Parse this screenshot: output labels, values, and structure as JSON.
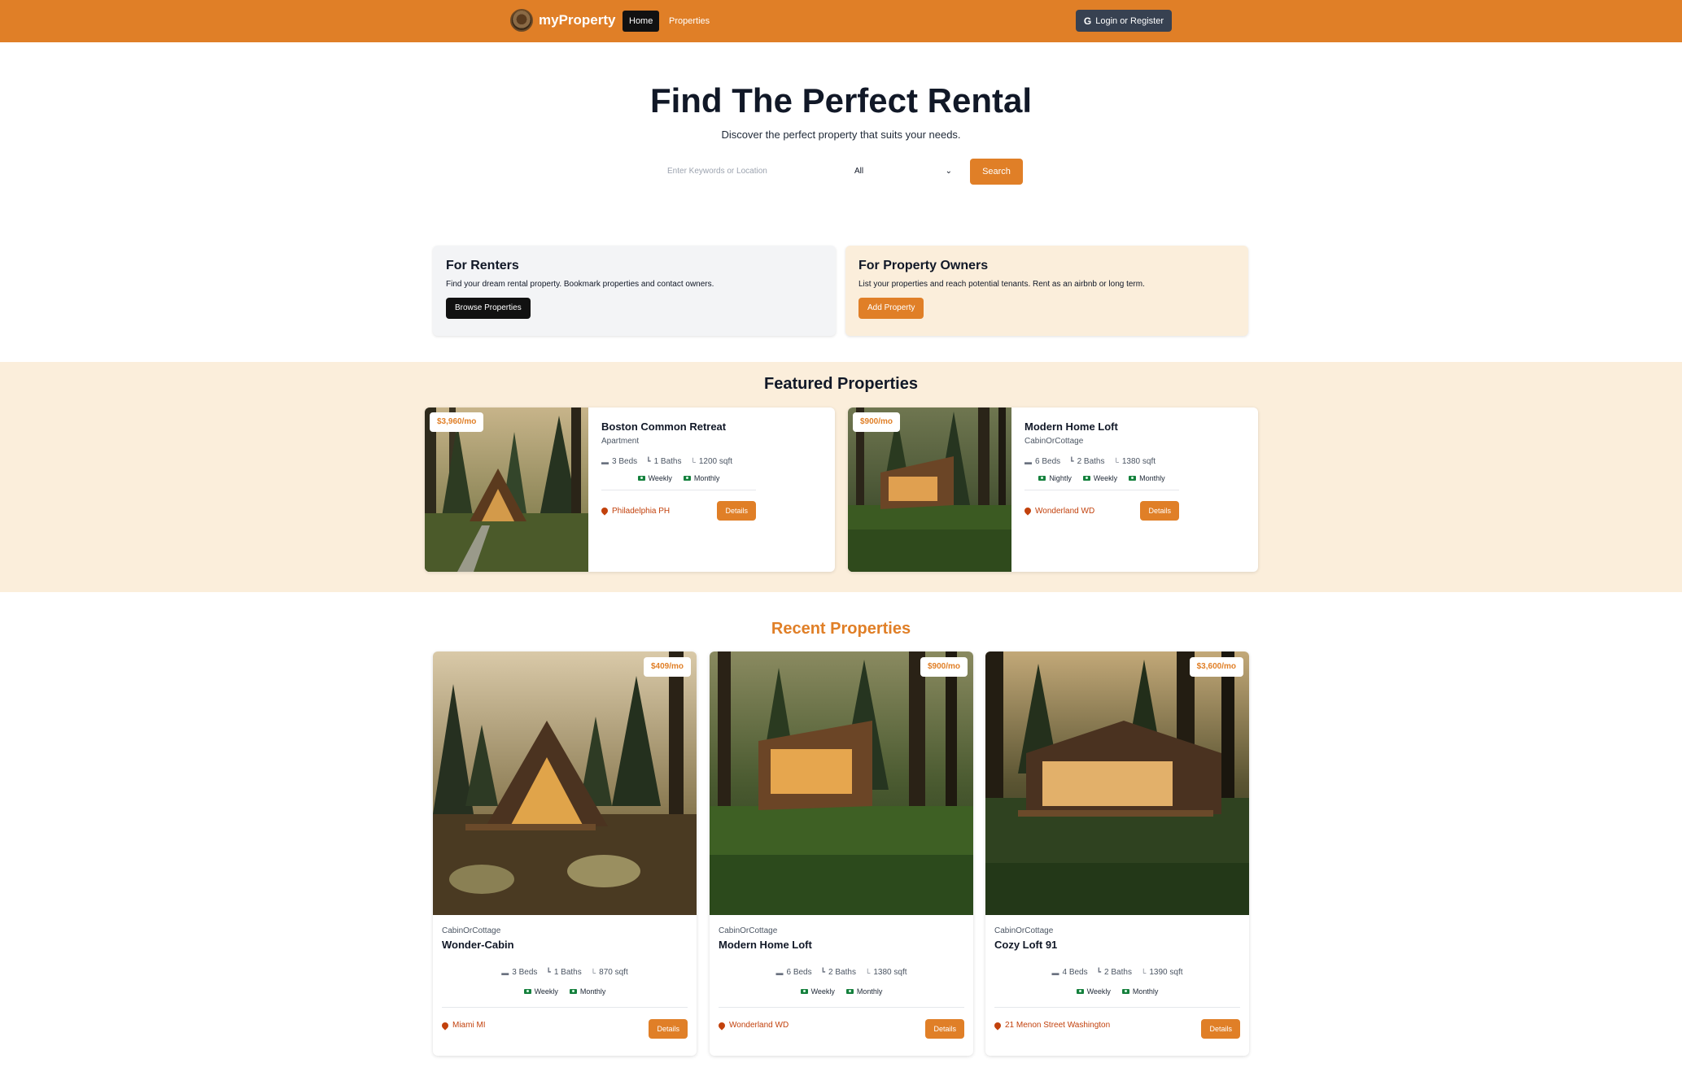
{
  "nav": {
    "brand": "myProperty",
    "links": [
      {
        "label": "Home",
        "active": true
      },
      {
        "label": "Properties",
        "active": false
      }
    ],
    "login_label": "Login or Register",
    "login_icon": "G"
  },
  "hero": {
    "title": "Find The Perfect Rental",
    "subtitle": "Discover the perfect property that suits your needs.",
    "search_placeholder": "Enter Keywords or Location",
    "type_selected": "All",
    "search_button": "Search"
  },
  "info": {
    "renters": {
      "title": "For Renters",
      "text": "Find your dream rental property. Bookmark properties and contact owners.",
      "button": "Browse Properties"
    },
    "owners": {
      "title": "For Property Owners",
      "text": "List your properties and reach potential tenants. Rent as an airbnb or long term.",
      "button": "Add Property"
    }
  },
  "featured": {
    "title": "Featured Properties",
    "items": [
      {
        "price": "$3,960/mo",
        "name": "Boston Common Retreat",
        "type": "Apartment",
        "beds": "3 Beds",
        "baths": "1 Baths",
        "sqft": "1200 sqft",
        "rates": [
          "Weekly",
          "Monthly"
        ],
        "location": "Philadelphia PH",
        "details": "Details"
      },
      {
        "price": "$900/mo",
        "name": "Modern Home Loft",
        "type": "CabinOrCottage",
        "beds": "6 Beds",
        "baths": "2 Baths",
        "sqft": "1380 sqft",
        "rates": [
          "Nightly",
          "Weekly",
          "Monthly"
        ],
        "location": "Wonderland WD",
        "details": "Details"
      }
    ]
  },
  "recent": {
    "title": "Recent Properties",
    "items": [
      {
        "price": "$409/mo",
        "type": "CabinOrCottage",
        "name": "Wonder-Cabin",
        "beds": "3 Beds",
        "baths": "1 Baths",
        "sqft": "870 sqft",
        "rates": [
          "Weekly",
          "Monthly"
        ],
        "location": "Miami MI",
        "details": "Details"
      },
      {
        "price": "$900/mo",
        "type": "CabinOrCottage",
        "name": "Modern Home Loft",
        "beds": "6 Beds",
        "baths": "2 Baths",
        "sqft": "1380 sqft",
        "rates": [
          "Weekly",
          "Monthly"
        ],
        "location": "Wonderland WD",
        "details": "Details"
      },
      {
        "price": "$3,600/mo",
        "type": "CabinOrCottage",
        "name": "Cozy Loft 91",
        "beds": "4 Beds",
        "baths": "2 Baths",
        "sqft": "1390 sqft",
        "rates": [
          "Weekly",
          "Monthly"
        ],
        "location": "21 Menon Street Washington",
        "details": "Details"
      }
    ]
  },
  "icons": {
    "bed": "bed-icon",
    "bath": "bath-icon",
    "ruler": "ruler-icon",
    "money": "money-icon",
    "pin": "map-pin-icon",
    "google": "google-icon",
    "chevron": "chevron-down-icon"
  },
  "colors": {
    "brand_orange": "#e07f27",
    "featured_bg": "#fbeedb",
    "renters_bg": "#f3f4f6",
    "dark_button": "#111111",
    "login_button": "#374151"
  }
}
